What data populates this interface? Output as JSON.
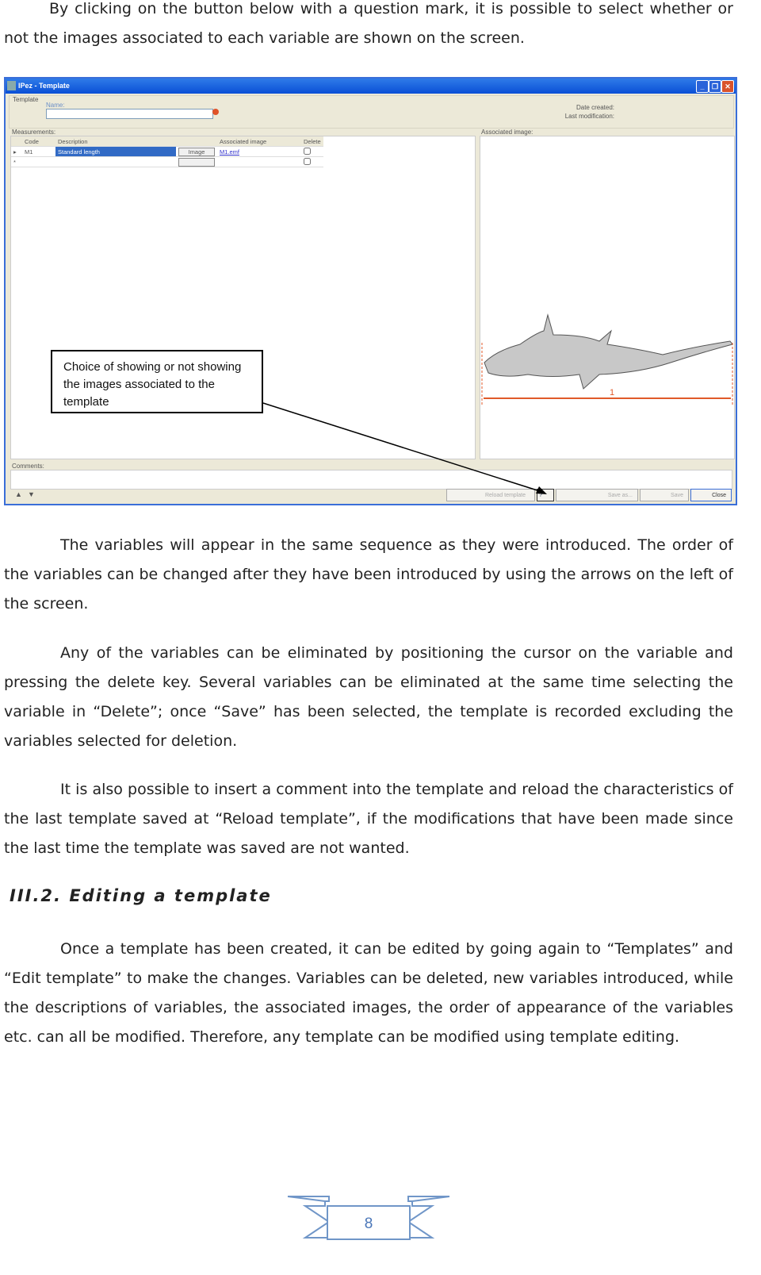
{
  "paragraphs": [
    "By clicking on the button below with a question mark, it is possible to select whether or not the images associated to each variable are shown on the screen.",
    "The variables will appear in the same sequence as they were introduced. The order of the variables can be changed after they have been introduced by using the arrows on the left of the screen.",
    "Any of the variables can be eliminated by positioning the cursor on the variable and pressing the delete key. Several variables can be eliminated at the same time selecting the variable in “Delete”; once “Save” has been selected, the template is recorded excluding the variables selected for deletion.",
    "It is also possible to insert a comment into the template and reload the characteristics of the last template saved at “Reload template”, if the modifications that have been made since the last time the template was saved are not wanted.",
    "Once a template has been created, it can be edited by going again to “Templates” and “Edit template” to make the changes. Variables can be deleted, new variables introduced, while the descriptions of variables, the associated images, the order of appearance of the variables etc. can all be modified. Therefore, any template can be modified using template editing."
  ],
  "heading": "III.2. Editing a template",
  "window": {
    "title": "IPez - Template",
    "template_group": "Template",
    "name_label": "Name:",
    "name_value": "",
    "date_created": "Date created:",
    "last_modification": "Last modification:",
    "measurements_label": "Measurements:",
    "columns": [
      "Code",
      "Description",
      "",
      "Associated image",
      "Delete"
    ],
    "rows": [
      {
        "code": "M1",
        "description": "Standard length",
        "button": "Image",
        "image": "M1.emf",
        "delete": false
      },
      {
        "code": "",
        "description": "",
        "button": "",
        "image": "",
        "delete": false
      }
    ],
    "associated_image_label": "Associated image:",
    "fish_measure_label": "1",
    "comments_label": "Comments:",
    "buttons": {
      "reload": "Reload template",
      "save_as": "Save as...",
      "save": "Save",
      "close": "Close"
    }
  },
  "callout": "Choice of showing or not showing the images associated to the template",
  "page_number": "8",
  "colors": {
    "titlebar": "#0a4fd6",
    "selection": "#316ac5",
    "ribbon": "#7096c8",
    "measure": "#e05a2a"
  }
}
